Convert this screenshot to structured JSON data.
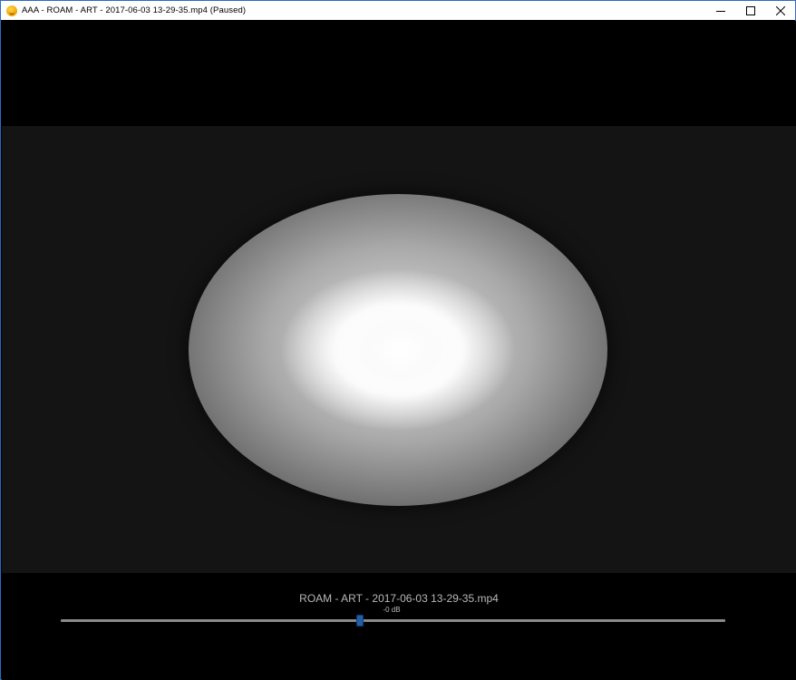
{
  "window": {
    "title": "AAA - ROAM - ART - 2017-06-03 13-29-35.mp4 (Paused)",
    "app_icon": "smiley-app-icon",
    "controls": [
      "minimize-icon",
      "maximize-icon",
      "close-icon"
    ]
  },
  "player": {
    "media_title": "ROAM - ART - 2017-06-03 13-29-35.mp4",
    "volume_label": "-0 dB",
    "seek_position": 0.45,
    "state": "Paused"
  },
  "colors": {
    "accent": "#1f5fa8",
    "background": "#000000"
  }
}
